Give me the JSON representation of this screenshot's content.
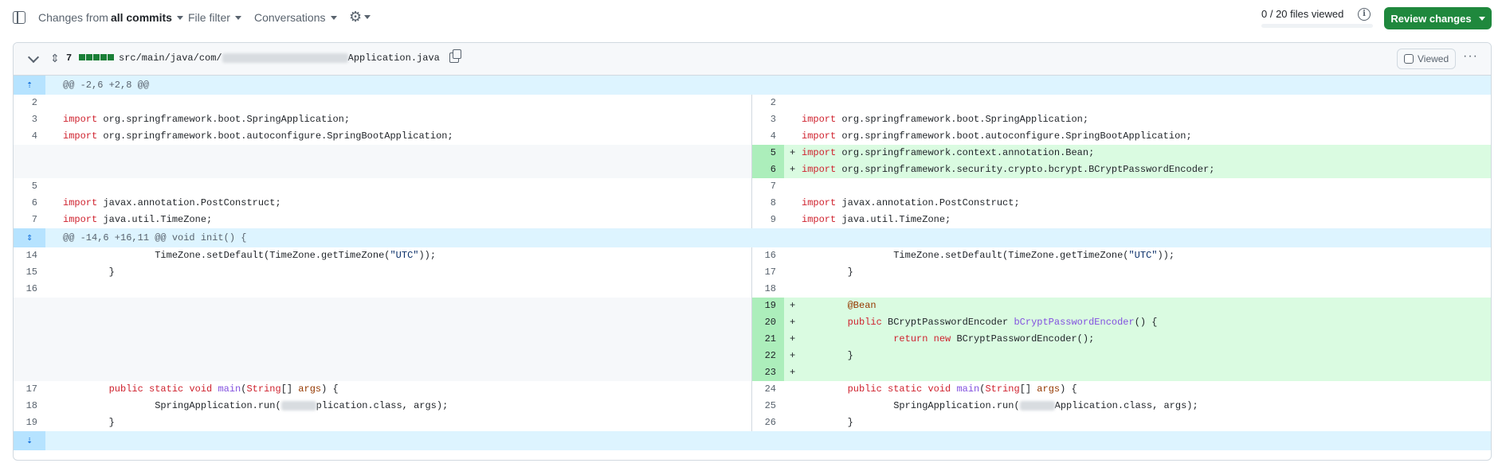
{
  "toolbar": {
    "changes_prefix": "Changes from",
    "changes_value": "all commits",
    "file_filter": "File filter",
    "conversations": "Conversations",
    "files_viewed": "0 / 20 files viewed",
    "files_viewed_progress": 0,
    "review_button": "Review changes"
  },
  "file": {
    "changed_count": "7",
    "path_prefix": "src/main/java/com/",
    "path_suffix": "Application.java",
    "viewed_label": "Viewed",
    "viewed_checked": false
  },
  "hunks": [
    {
      "header": "@@ -2,6 +2,8 @@"
    },
    {
      "header": "@@ -14,6 +16,11 @@ void init() {"
    }
  ],
  "colors": {
    "added_bg": "#dafbe1",
    "added_gutter": "#aceebb",
    "hunk_bg": "#ddf4ff",
    "primary_button": "#1f883d"
  },
  "diff_lines": {
    "l2": "2",
    "r2": "2",
    "l3": "3",
    "r3": "3",
    "l4": "4",
    "r4": "4",
    "r5": "5",
    "r6": "6",
    "l5": "5",
    "r7": "7",
    "l6": "6",
    "r8": "8",
    "l7": "7",
    "r9": "9",
    "l14": "14",
    "r16": "16",
    "l15": "15",
    "r17": "17",
    "l16": "16",
    "r18": "18",
    "r19": "19",
    "r20": "20",
    "r21": "21",
    "r22": "22",
    "r23": "23",
    "l17": "17",
    "r24": "24",
    "l18": "18",
    "r25": "25",
    "l19": "19",
    "r26": "26"
  },
  "code": {
    "import_kw": "import",
    "spring_app": " org.springframework.boot.SpringApplication;",
    "spring_boot_app": " org.springframework.boot.autoconfigure.SpringBootApplication;",
    "bean_import": " org.springframework.context.annotation.Bean;",
    "bcrypt_import": " org.springframework.security.crypto.bcrypt.BCryptPasswordEncoder;",
    "post_construct": " javax.annotation.PostConstruct;",
    "timezone_import": " java.util.TimeZone;",
    "tz_line_pre": "                TimeZone.setDefault(TimeZone.getTimeZone(",
    "tz_line_str": "\"UTC\"",
    "tz_line_post": "));",
    "close_brace_8": "        }",
    "bean_annot": "@Bean",
    "public_kw": "public",
    "bcrypt_type": " BCryptPasswordEncoder ",
    "bcrypt_fn": "bCryptPasswordEncoder",
    "bcrypt_tail": "() {",
    "return_kw": "return",
    "new_kw": "new",
    "bcrypt_ctor": " BCryptPasswordEncoder();",
    "static_void": "static void",
    "main_fn": "main",
    "string_type": "String",
    "args_kw": "args",
    "main_tail": ") {",
    "run_pre": "                SpringApplication.run(",
    "run_left_suffix": "plication.class, args);",
    "run_right_suffix": "Application.class, args);"
  }
}
